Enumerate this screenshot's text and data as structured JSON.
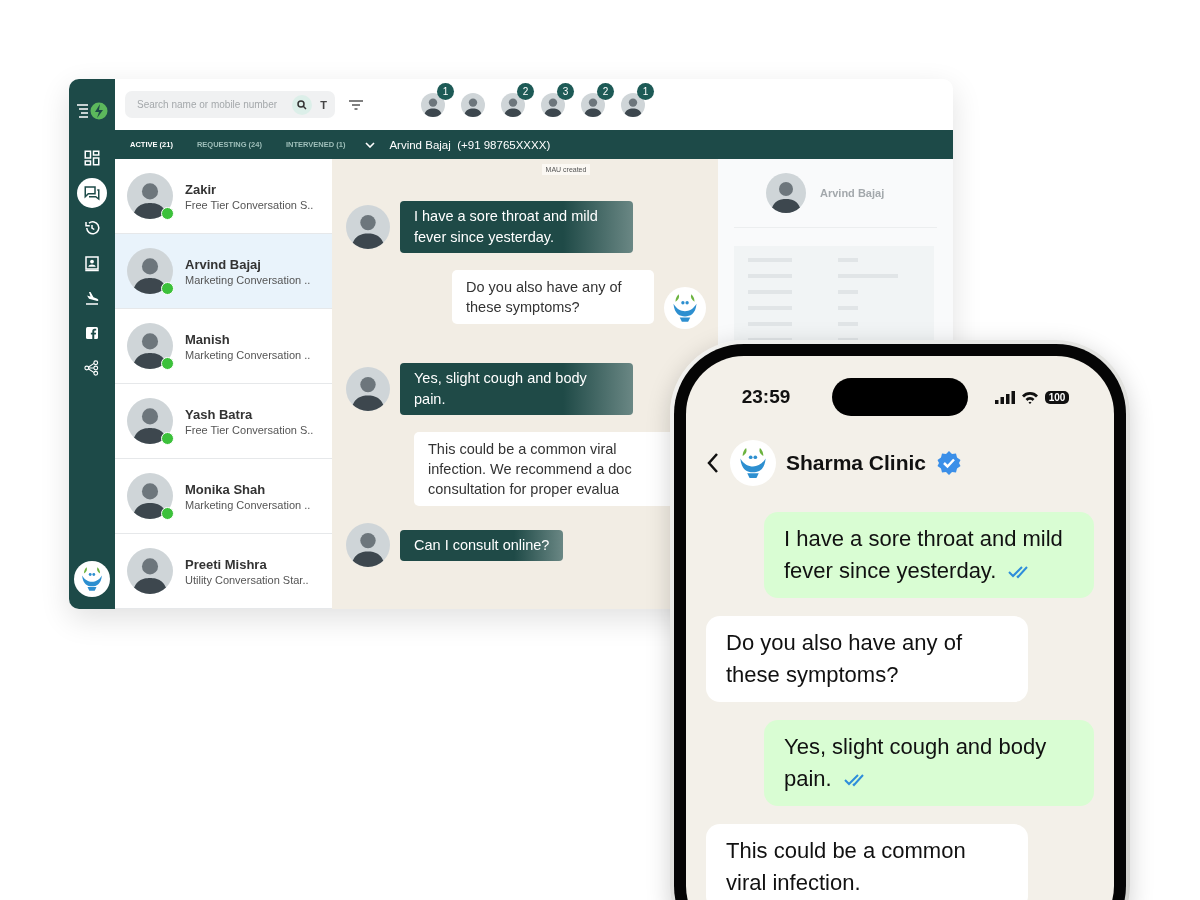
{
  "dashboard": {
    "rail_items": [
      {
        "kind": "grid",
        "selected": false
      },
      {
        "kind": "chat",
        "selected": true
      },
      {
        "kind": "history",
        "selected": false
      },
      {
        "kind": "contact",
        "selected": false
      },
      {
        "kind": "flight",
        "selected": false
      },
      {
        "kind": "facebook",
        "selected": false
      },
      {
        "kind": "flow",
        "selected": false
      }
    ],
    "search": {
      "placeholder": "Search name or mobile number",
      "filter_letter": "T"
    },
    "queue_avatars": [
      {
        "kind": "badged",
        "badge": "1"
      },
      {
        "kind": "plain"
      },
      {
        "kind": "badged",
        "badge": "2"
      },
      {
        "kind": "badged",
        "badge": "3"
      },
      {
        "kind": "badged",
        "badge": "2"
      },
      {
        "kind": "badged",
        "badge": "1"
      }
    ],
    "tabs": [
      {
        "label": "ACTIVE (21)",
        "selected": true
      },
      {
        "label": "REQUESTING (24)",
        "selected": false
      },
      {
        "label": "INTERVENED (1)",
        "selected": false
      }
    ],
    "chat_header": {
      "name": "Arvind Bajaj",
      "phone": "(+91 98765XXXX)"
    },
    "contacts": [
      {
        "name": "Zakir",
        "subtitle": "Free Tier Conversation S..",
        "selected": false,
        "online": true
      },
      {
        "name": "Arvind Bajaj",
        "subtitle": "Marketing Conversation ..",
        "selected": true,
        "online": true
      },
      {
        "name": "Manish",
        "subtitle": "Marketing Conversation ..",
        "selected": false,
        "online": true
      },
      {
        "name": "Yash Batra",
        "subtitle": "Free Tier Conversation S..",
        "selected": false,
        "online": true
      },
      {
        "name": "Monika Shah",
        "subtitle": "Marketing Conversation ..",
        "selected": false,
        "online": true
      },
      {
        "name": "Preeti Mishra",
        "subtitle": "Utility Conversation Star..",
        "selected": false,
        "online": false
      }
    ],
    "system_note": "MAU created",
    "messages": [
      {
        "kind": "incoming",
        "text": "I have a sore throat and mild fever since yesterday."
      },
      {
        "kind": "outgoing",
        "text": "Do you also have any of these symptoms?",
        "logo": true
      },
      {
        "kind": "incoming",
        "text": "Yes, slight cough and body pain."
      },
      {
        "kind": "outgoing",
        "text": "This could be a common viral infection. We recommend a doc consultation for proper evalua",
        "logo": false
      },
      {
        "kind": "incoming",
        "text": "Can I consult online?"
      }
    ],
    "profile": {
      "name": "Arvind Bajaj"
    }
  },
  "phone": {
    "time": "23:59",
    "battery": "100",
    "contact": {
      "name": "Sharma Clinic",
      "verified": true
    },
    "messages": [
      {
        "kind": "outgoing",
        "text": "I have a sore throat and mild fever since yesterday.",
        "read": true
      },
      {
        "kind": "incoming",
        "text": "Do you also have any of these symptoms?"
      },
      {
        "kind": "outgoing",
        "text": "Yes, slight cough and body pain.",
        "read": true
      },
      {
        "kind": "incoming",
        "text": "This could be a common viral infection."
      }
    ]
  }
}
